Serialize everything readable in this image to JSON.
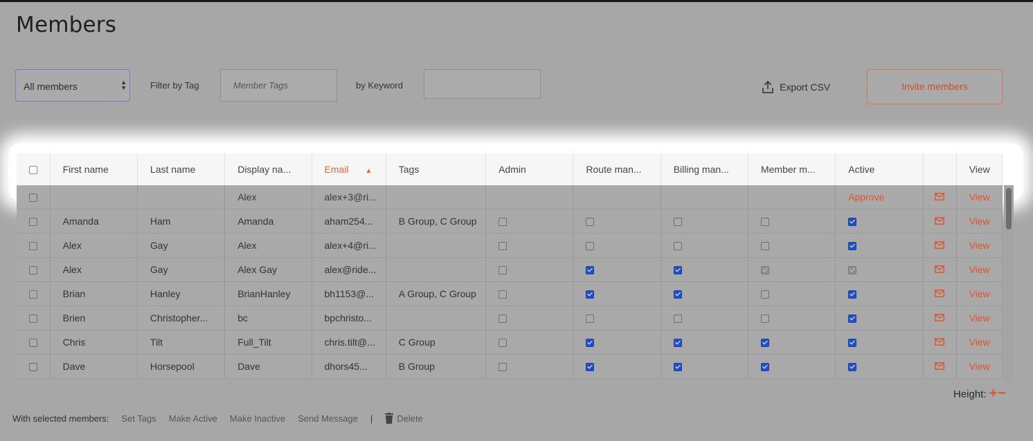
{
  "page": {
    "title": "Members"
  },
  "filters": {
    "member_select": "All members",
    "filter_by_tag_label": "Filter by Tag",
    "tag_placeholder": "Member Tags",
    "keyword_label": "by Keyword",
    "keyword_value": ""
  },
  "actions": {
    "export_label": "Export CSV",
    "invite_label": "Invite members"
  },
  "table": {
    "headers": [
      "First name",
      "Last name",
      "Display na...",
      "Email",
      "Tags",
      "Admin",
      "Route man...",
      "Billing man...",
      "Member m...",
      "Active",
      "View"
    ],
    "rows": [
      {
        "first": "",
        "last": "",
        "display": "Alex",
        "email": "alex+3@ri...",
        "tags": "",
        "admin": null,
        "route": null,
        "billing": null,
        "member": null,
        "active": "Approve",
        "view": "View"
      },
      {
        "first": "Amanda",
        "last": "Ham",
        "display": "Amanda",
        "email": "aham254...",
        "tags": "B Group, C Group",
        "admin": "off",
        "route": "off",
        "billing": "off",
        "member": "off",
        "active": "on",
        "view": "View"
      },
      {
        "first": "Alex",
        "last": "Gay",
        "display": "Alex",
        "email": "alex+4@ri...",
        "tags": "",
        "admin": "off",
        "route": "off",
        "billing": "off",
        "member": "off",
        "active": "on",
        "view": "View"
      },
      {
        "first": "Alex",
        "last": "Gay",
        "display": "Alex Gay",
        "email": "alex@ride...",
        "tags": "",
        "admin": "off",
        "route": "on",
        "billing": "on",
        "member": "dis",
        "active": "dis",
        "view": "View"
      },
      {
        "first": "Brian",
        "last": "Hanley",
        "display": "BrianHanley",
        "email": "bh1153@...",
        "tags": "A Group, C Group",
        "admin": "off",
        "route": "on",
        "billing": "on",
        "member": "off",
        "active": "on",
        "view": "View"
      },
      {
        "first": "Brien",
        "last": "Christopher...",
        "display": "bc",
        "email": "bpchristo...",
        "tags": "",
        "admin": "off",
        "route": "off",
        "billing": "off",
        "member": "off",
        "active": "on",
        "view": "View"
      },
      {
        "first": "Chris",
        "last": "Tilt",
        "display": "Full_Tilt",
        "email": "chris.tilt@...",
        "tags": "C Group",
        "admin": "off",
        "route": "on",
        "billing": "on",
        "member": "on",
        "active": "on",
        "view": "View"
      },
      {
        "first": "Dave",
        "last": "Horsepool",
        "display": "Dave",
        "email": "dhors45...",
        "tags": "B Group",
        "admin": "off",
        "route": "on",
        "billing": "on",
        "member": "on",
        "active": "on",
        "view": "View"
      }
    ]
  },
  "height_control": {
    "label": "Height:",
    "plus": "+",
    "minus": "−"
  },
  "bulk": {
    "label": "With selected members:",
    "set_tags": "Set Tags",
    "make_active": "Make Active",
    "make_inactive": "Make Inactive",
    "send_message": "Send Message",
    "separator": "|",
    "delete": "Delete"
  },
  "icons": {
    "export": "upload-icon",
    "mail": "mail-icon",
    "trash": "trash-icon",
    "sort": "sort-asc-icon"
  },
  "colors": {
    "accent": "#e0522a",
    "check": "#1f4fd1"
  }
}
